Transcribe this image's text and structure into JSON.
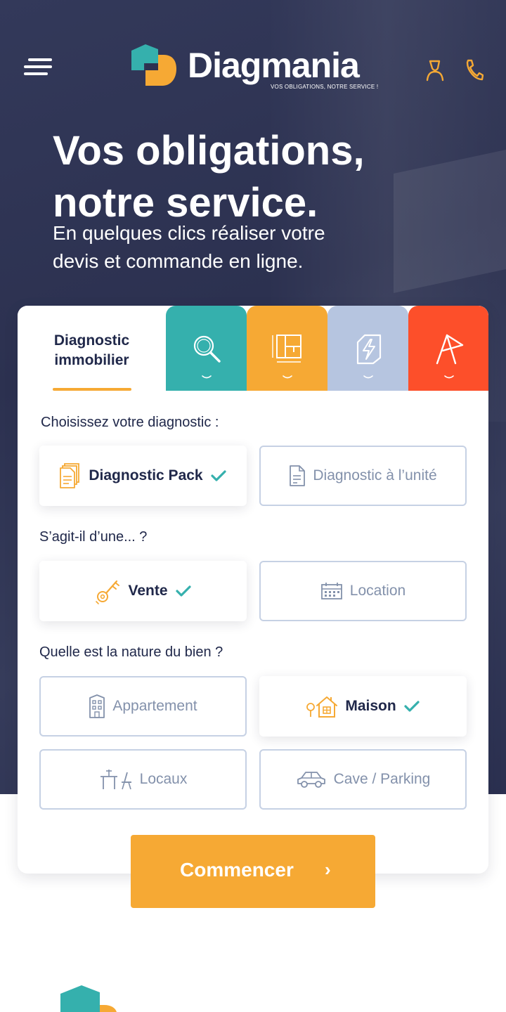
{
  "brand": {
    "name": "Diagmania",
    "tagline": "VOS OBLIGATIONS, NOTRE SERVICE !",
    "teal": "#35b0ad",
    "orange": "#f6a934",
    "red": "#fd4f2a",
    "grey": "#b6c5e0",
    "navy": "#2c3150"
  },
  "header": {
    "menu_icon": "hamburger-icon",
    "user_icon": "user-icon",
    "phone_icon": "phone-icon"
  },
  "hero": {
    "title_line1": "Vos obligations,",
    "title_line2": "notre service.",
    "subtitle_line1": "En quelques clics réaliser votre",
    "subtitle_line2": "devis et commande en ligne."
  },
  "tabs": [
    {
      "label_line1": "Diagnostic",
      "label_line2": "immobilier",
      "active": true
    },
    {
      "icon": "search-icon",
      "color": "#35b0ad"
    },
    {
      "icon": "floor-plan-icon",
      "color": "#f6a934"
    },
    {
      "icon": "energy-icon",
      "color": "#b6c5e0"
    },
    {
      "icon": "asbestos-sign-icon",
      "color": "#fd4f2a"
    }
  ],
  "form": {
    "q1": "Choisissez votre diagnostic :",
    "q1_options": [
      {
        "label": "Diagnostic Pack",
        "icon": "documents-icon",
        "selected": true
      },
      {
        "label": "Diagnostic à l’unité",
        "icon": "document-icon",
        "selected": false
      }
    ],
    "q2": "S’agit-il d’une... ?",
    "q2_options": [
      {
        "label": "Vente",
        "icon": "key-icon",
        "selected": true
      },
      {
        "label": "Location",
        "icon": "calendar-icon",
        "selected": false
      }
    ],
    "q3": "Quelle est la nature du bien ?",
    "q3_options": [
      {
        "label": "Appartement",
        "icon": "building-icon",
        "selected": false
      },
      {
        "label": "Maison",
        "icon": "house-icon",
        "selected": true
      },
      {
        "label": "Locaux",
        "icon": "office-desk-icon",
        "selected": false
      },
      {
        "label": "Cave / Parking",
        "icon": "car-icon",
        "selected": false
      }
    ]
  },
  "cta": {
    "label": "Commencer",
    "arrow": "›"
  }
}
